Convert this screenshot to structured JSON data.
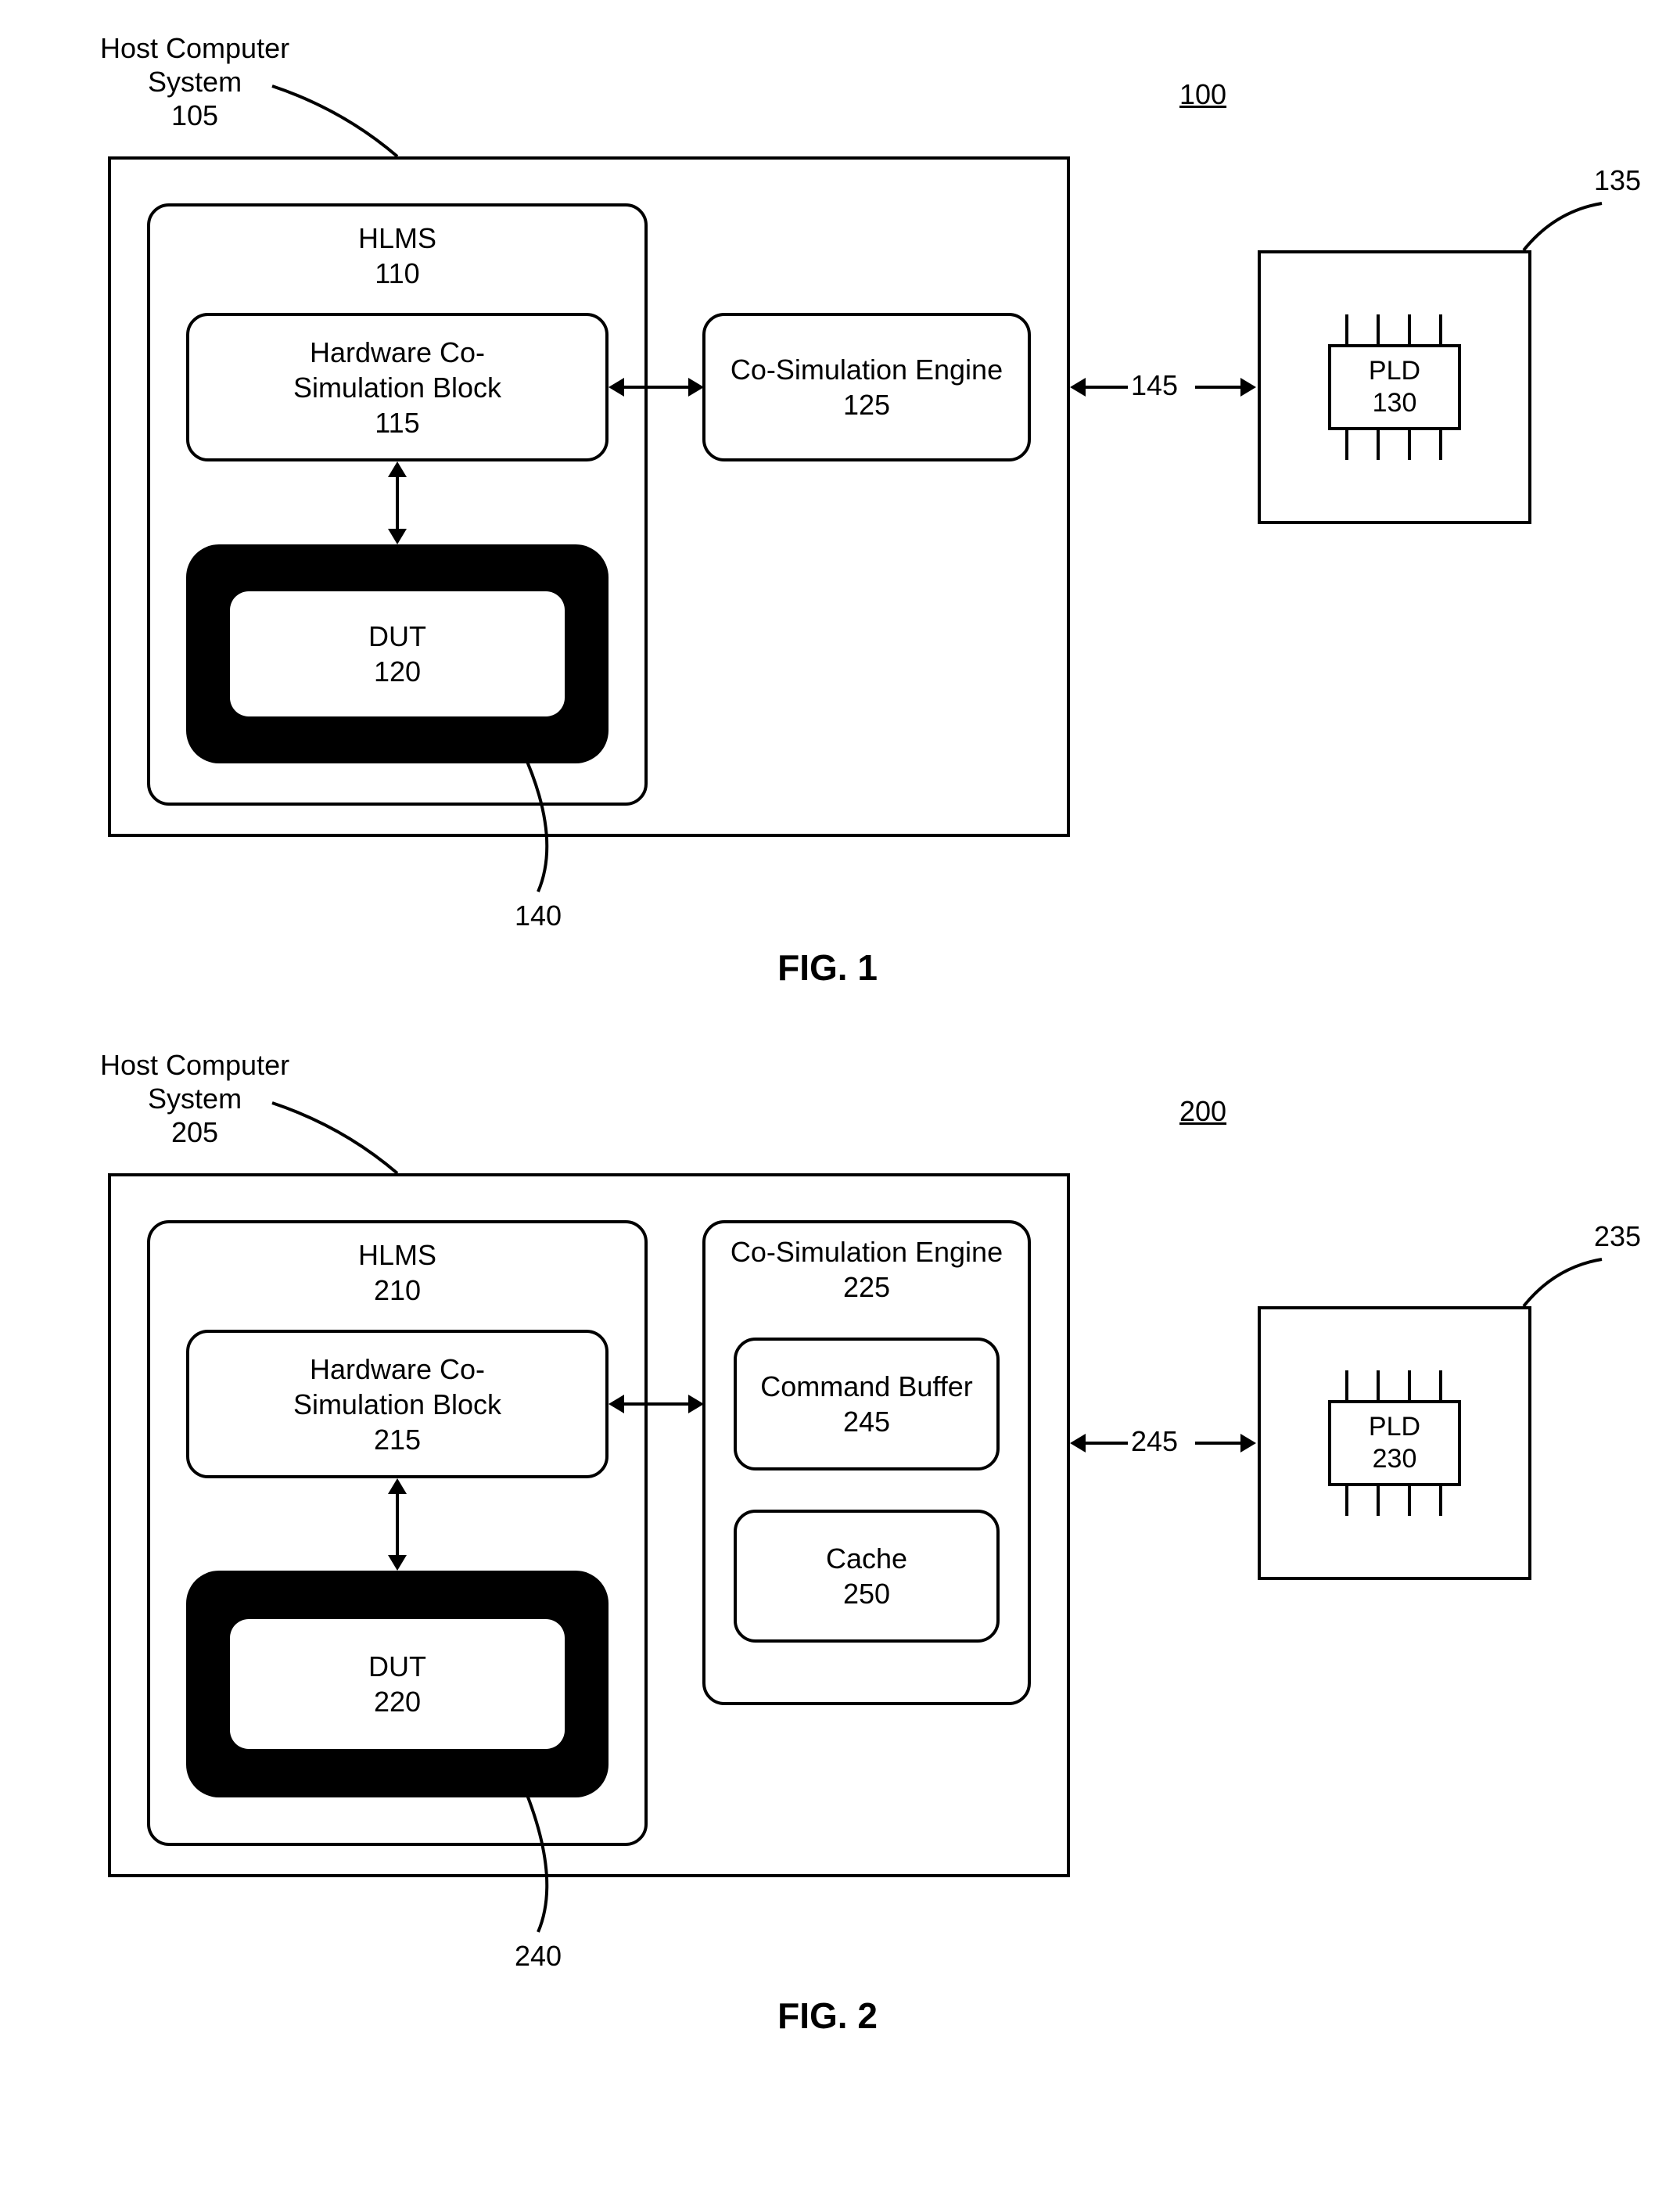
{
  "fig1": {
    "ref": "100",
    "host_label_l1": "Host Computer",
    "host_label_l2": "System",
    "host_num": "105",
    "hlms_label": "HLMS",
    "hlms_num": "110",
    "hwcosim_l1": "Hardware Co-",
    "hwcosim_l2": "Simulation Block",
    "hwcosim_num": "115",
    "dut_label": "DUT",
    "dut_num": "120",
    "cosim_l1": "Co-Simulation Engine",
    "cosim_num": "125",
    "pld_label": "PLD",
    "pld_num": "130",
    "hw_num": "135",
    "dut_callout": "140",
    "link_num": "145",
    "caption": "FIG. 1"
  },
  "fig2": {
    "ref": "200",
    "host_label_l1": "Host Computer",
    "host_label_l2": "System",
    "host_num": "205",
    "hlms_label": "HLMS",
    "hlms_num": "210",
    "hwcosim_l1": "Hardware Co-",
    "hwcosim_l2": "Simulation Block",
    "hwcosim_num": "215",
    "dut_label": "DUT",
    "dut_num": "220",
    "cosim_l1": "Co-Simulation Engine",
    "cosim_num": "225",
    "cmdbuf_l1": "Command Buffer",
    "cmdbuf_num": "245",
    "cache_l1": "Cache",
    "cache_num": "250",
    "pld_label": "PLD",
    "pld_num": "230",
    "hw_num": "235",
    "dut_callout": "240",
    "link_num": "245",
    "caption": "FIG. 2"
  }
}
